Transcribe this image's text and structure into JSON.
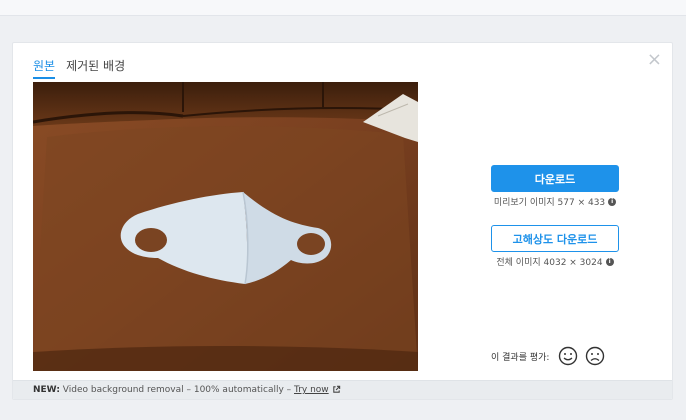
{
  "tabs": [
    {
      "label": "원본",
      "active": true
    },
    {
      "label": "제거된 배경",
      "active": false
    }
  ],
  "close_label": "×",
  "download": {
    "label": "다운로드",
    "preview_info": "미리보기 이미지 577 × 433"
  },
  "hd_download": {
    "label": "고해상도 다운로드",
    "full_info": "전체 이미지 4032 × 3024"
  },
  "rating": {
    "label": "이 결과를 평가:"
  },
  "footer": {
    "new_label": "NEW:",
    "message": " Video background removal – 100% automatically – ",
    "link": "Try now"
  },
  "icons": {
    "close": "close-icon",
    "info": "info-icon",
    "happy": "smile-icon",
    "sad": "frown-icon",
    "external": "external-link-icon"
  },
  "colors": {
    "accent": "#1e92ea",
    "sofa": "#7a4422",
    "mask": "#dbe6ee"
  }
}
